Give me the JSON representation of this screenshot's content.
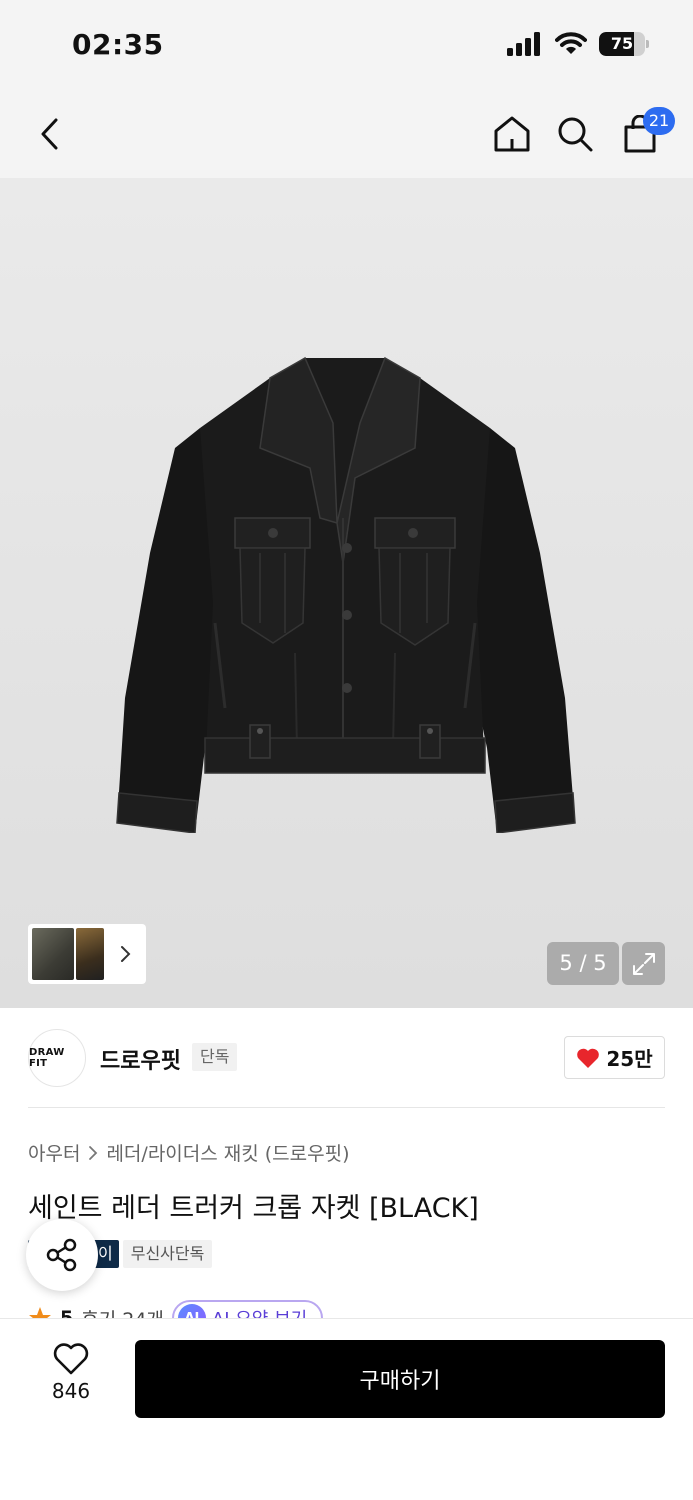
{
  "status_bar": {
    "time": "02:35",
    "battery_level": "75",
    "battery_fraction": 0.75
  },
  "nav": {
    "icons": [
      "back-chevron-icon",
      "home-icon",
      "search-icon",
      "cart-icon"
    ],
    "cart_count": "21",
    "badge_color": "#2d6cf0"
  },
  "gallery": {
    "page_indicator": "5 / 5",
    "current_page": 5,
    "total_pages": 5
  },
  "brand": {
    "logo_text": "DRAW FIT",
    "name": "드로우핏",
    "tag": "단독",
    "like_count": "25만",
    "heart_color": "#e8262c"
  },
  "breadcrumb": {
    "category": "아우터",
    "subcategory": "레더/라이더스 재킷 (드로우핏)"
  },
  "product": {
    "title": "세인트 레더 트러커 크롭 자켓 [BLACK]",
    "tags": [
      "이",
      "무신사단독"
    ],
    "rating": "5",
    "review_count": "후기 24개",
    "ai_badge": "AI",
    "ai_summary": "AI 요약 보기"
  },
  "bottom_bar": {
    "wish_count": "846",
    "buy_label": "구매하기"
  }
}
